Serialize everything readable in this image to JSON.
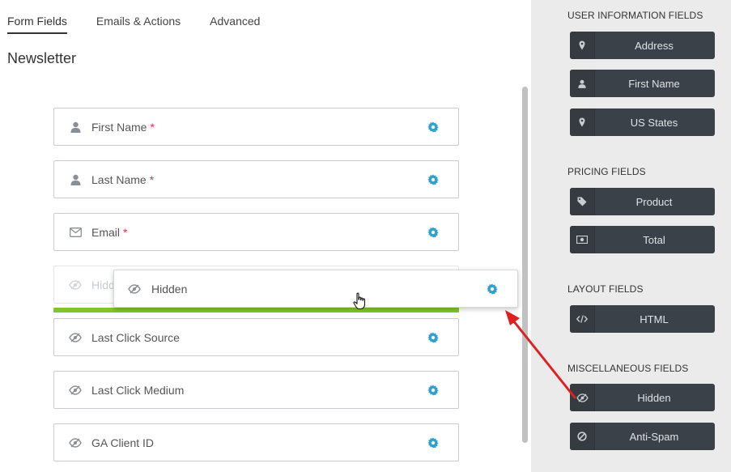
{
  "tabs": [
    {
      "label": "Form Fields",
      "active": true
    },
    {
      "label": "Emails & Actions",
      "active": false
    },
    {
      "label": "Advanced",
      "active": false
    }
  ],
  "form": {
    "title": "Newsletter",
    "fields": [
      {
        "label": "First Name",
        "required": "*",
        "icon": "user-icon"
      },
      {
        "label": "Last Name",
        "required": "*",
        "icon": "user-icon"
      },
      {
        "label": "Email",
        "required": "*",
        "icon": "envelope-icon"
      },
      {
        "label": "Hidden",
        "required": "",
        "icon": "eye-slash-icon"
      },
      {
        "label": "Last Click Source",
        "required": "",
        "icon": "eye-slash-icon"
      },
      {
        "label": "Last Click Medium",
        "required": "",
        "icon": "eye-slash-icon"
      },
      {
        "label": "GA Client ID",
        "required": "",
        "icon": "eye-slash-icon"
      }
    ],
    "ghost_label": "Hidd",
    "dragging_label": "Hidden"
  },
  "sidebar": {
    "sections": [
      {
        "heading": "USER INFORMATION FIELDS",
        "items": [
          {
            "label": "Address",
            "icon": "map-marker-icon"
          },
          {
            "label": "First Name",
            "icon": "user-icon"
          },
          {
            "label": "US States",
            "icon": "map-marker-icon"
          }
        ]
      },
      {
        "heading": "PRICING FIELDS",
        "items": [
          {
            "label": "Product",
            "icon": "tag-icon"
          },
          {
            "label": "Total",
            "icon": "money-icon"
          }
        ]
      },
      {
        "heading": "LAYOUT FIELDS",
        "items": [
          {
            "label": "HTML",
            "icon": "code-icon"
          }
        ]
      },
      {
        "heading": "MISCELLANEOUS FIELDS",
        "items": [
          {
            "label": "Hidden",
            "icon": "eye-slash-icon"
          },
          {
            "label": "Anti-Spam",
            "icon": "ban-icon"
          }
        ]
      }
    ]
  },
  "colors": {
    "accent_blue": "#2ea2cc",
    "drop_green": "#80c62b",
    "sidebar_button": "#3a4148",
    "arrow_red": "#e02020"
  }
}
